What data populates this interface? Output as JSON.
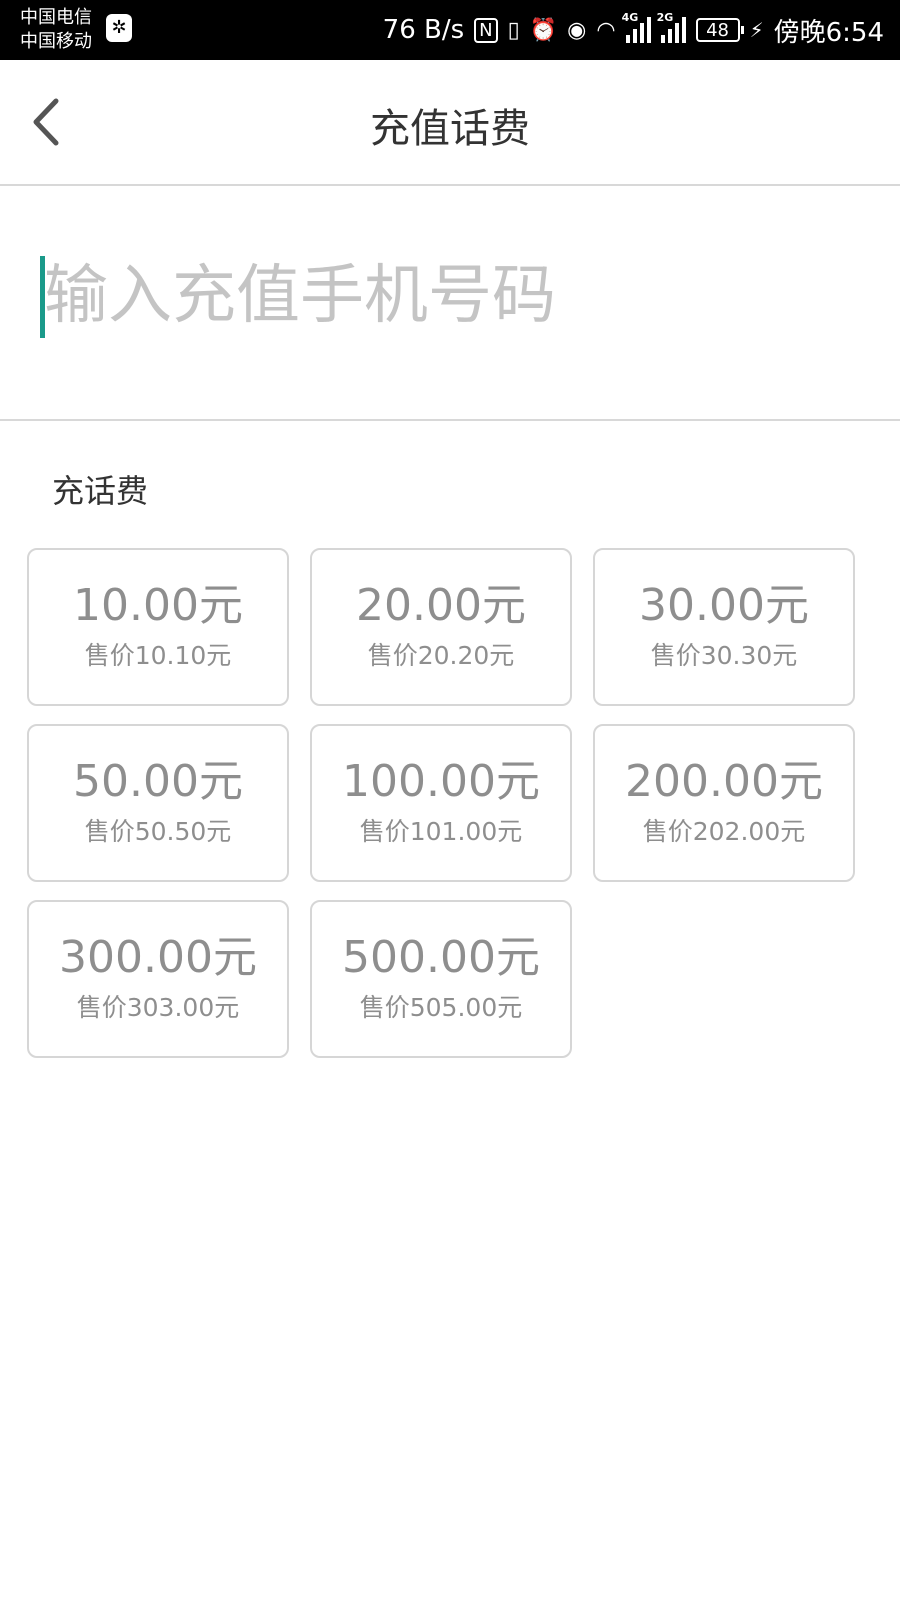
{
  "status_bar": {
    "carrier_1": "中国电信",
    "carrier_2": "中国移动",
    "app_icon": "notification-app-icon",
    "net_speed": "76 B/s",
    "nfc": "N",
    "sim1_tag": "4G",
    "sim2_tag": "2G",
    "battery": "48",
    "time": "傍晚6:54"
  },
  "header": {
    "title": "充值话费",
    "back_icon": "chevron-left-icon"
  },
  "phone_input": {
    "placeholder": "输入充值手机号码",
    "value": ""
  },
  "section": {
    "label": "充话费"
  },
  "options": [
    {
      "value": "10.00元",
      "price": "售价10.10元"
    },
    {
      "value": "20.00元",
      "price": "售价20.20元"
    },
    {
      "value": "30.00元",
      "price": "售价30.30元"
    },
    {
      "value": "50.00元",
      "price": "售价50.50元"
    },
    {
      "value": "100.00元",
      "price": "售价101.00元"
    },
    {
      "value": "200.00元",
      "price": "售价202.00元"
    },
    {
      "value": "300.00元",
      "price": "售价303.00元"
    },
    {
      "value": "500.00元",
      "price": "售价505.00元"
    }
  ],
  "colors": {
    "accent": "#1a9a8a",
    "card_border": "#d6d6d6",
    "card_text": "#8e8e8e",
    "title_text": "#333333",
    "placeholder": "#c4c4c4"
  }
}
